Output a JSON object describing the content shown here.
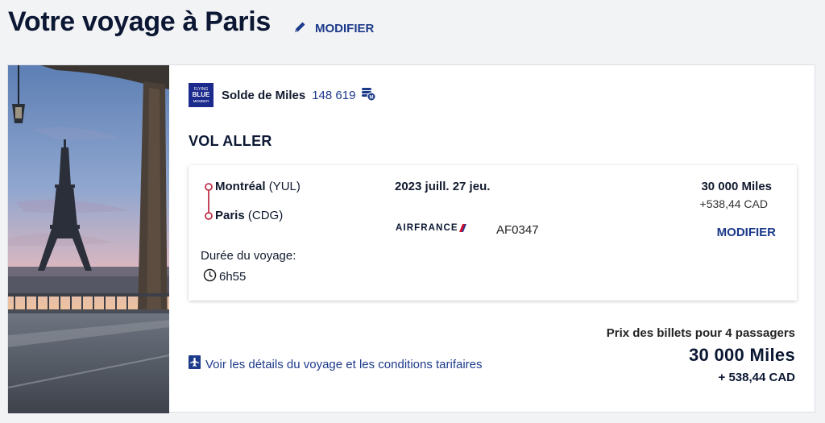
{
  "header": {
    "title": "Votre voyage à Paris",
    "modify_label": "MODIFIER"
  },
  "miles_balance": {
    "program_logo_text": [
      "FLYING",
      "BLUE",
      "MEMBER"
    ],
    "label": "Solde de Miles",
    "value": "148 619"
  },
  "outbound": {
    "section_title": "VOL ALLER",
    "origin_city": "Montréal",
    "origin_code": "(YUL)",
    "destination_city": "Paris",
    "destination_code": "(CDG)",
    "duration_label": "Durée du voyage:",
    "duration_value": "6h55",
    "date": "2023 juill. 27 jeu.",
    "airline_name": "AIRFRANCE",
    "flight_number": "AF0347",
    "price_miles": "30 000  Miles",
    "price_cad": "+538,44 CAD",
    "modify_label": "MODIFIER"
  },
  "summary": {
    "details_link": "Voir les détails du voyage et les conditions tarifaires",
    "total_label": "Prix des billets pour 4 passagers",
    "total_miles": "30 000  Miles",
    "total_cad": "+ 538,44 CAD"
  },
  "colors": {
    "link_blue": "#1c3a8a",
    "route_red": "#c0334a",
    "flying_blue": "#1b2a8c",
    "airfrance_red": "#d4102a"
  },
  "icons": [
    "pencil-icon",
    "miles-coins-icon",
    "clock-icon",
    "airplane-document-icon",
    "airfrance-logo-icon",
    "eiffel-tower-photo"
  ]
}
